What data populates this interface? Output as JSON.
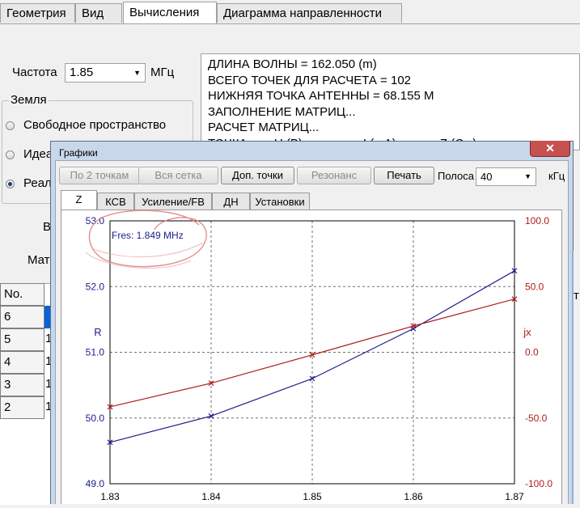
{
  "main_tabs": [
    "Геометрия",
    "Вид",
    "Вычисления",
    "Диаграмма направленности"
  ],
  "frequency": {
    "label": "Частота",
    "value": "1.85",
    "unit": "МГц"
  },
  "ground": {
    "title": "Земля",
    "options": [
      "Свободное пространство",
      "Идеа",
      "Реал"
    ],
    "selected": "Реал"
  },
  "partial_labels": {
    "left1": "В",
    "left2": "Мат"
  },
  "log_lines": [
    "ДЛИНА ВОЛНЫ = 162.050 (m)",
    "ВСЕГО ТОЧЕК ДЛЯ РАСЧЕТА = 102",
    "НИЖНЯЯ ТОЧКА АНТЕННЫ = 68.155 M",
    "ЗАПОЛНЕНИЕ МАТРИЦ...",
    "РАСЧЕТ МАТРИЦ...",
    "ТОЧКА        U (B)                  I (mA)             Z (Ом)"
  ],
  "table": {
    "header": "No.",
    "rows": [
      "6",
      "5",
      "4",
      "3",
      "2"
    ],
    "second_col": [
      "",
      "1",
      "1",
      "1",
      "1"
    ],
    "right_fragment": "т"
  },
  "dialog": {
    "title": "Графики",
    "close": "✕",
    "buttons": [
      {
        "label": "По 2 точкам",
        "enabled": false
      },
      {
        "label": "Вся сетка",
        "enabled": false
      },
      {
        "label": "Доп. точки",
        "enabled": true
      },
      {
        "label": "Резонанс",
        "enabled": false
      },
      {
        "label": "Печать",
        "enabled": true
      }
    ],
    "band_label": "Полоса",
    "band_value": "40",
    "band_unit": "кГц",
    "tabs": [
      "Z",
      "КСВ",
      "Усиление/FB",
      "ДН",
      "Установки"
    ],
    "active_tab": "Z",
    "annotation": "Fres: 1.849 MHz"
  },
  "colors": {
    "r_series": "#1c1c8c",
    "jx_series": "#b01c1c",
    "grid": "#707070"
  },
  "chart_data": {
    "type": "line",
    "x": [
      1.83,
      1.84,
      1.85,
      1.86,
      1.87
    ],
    "xlim": [
      1.83,
      1.87
    ],
    "x_ticks": [
      "1.83",
      "1.84",
      "1.85",
      "1.86",
      "1.87"
    ],
    "y_left": {
      "label": "R",
      "lim": [
        49.0,
        53.0
      ],
      "ticks": [
        "49.0",
        "50.0",
        "51.0",
        "52.0",
        "53.0"
      ]
    },
    "y_right": {
      "label": "jx",
      "lim": [
        -100.0,
        100.0
      ],
      "ticks": [
        "-100.0",
        "-50.0",
        "0.0",
        "50.0",
        "100.0"
      ]
    },
    "series": [
      {
        "name": "R",
        "axis": "left",
        "values": [
          49.63,
          50.03,
          50.6,
          51.36,
          52.24
        ]
      },
      {
        "name": "jx",
        "axis": "right",
        "values": [
          -41.5,
          -23.5,
          -2.0,
          20.0,
          40.5
        ]
      }
    ],
    "grid": true
  }
}
